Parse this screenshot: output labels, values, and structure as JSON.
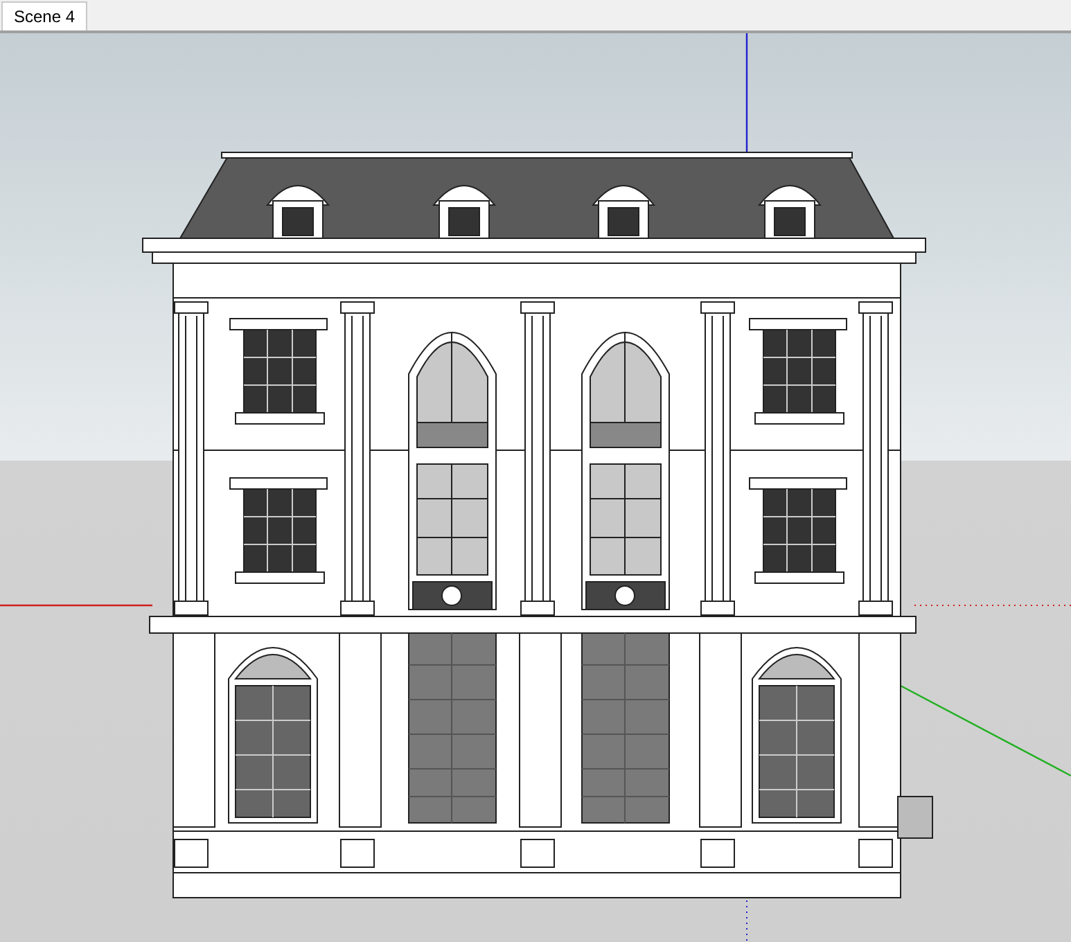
{
  "scene_tabs": [
    {
      "label": "Scene 4",
      "selected": true
    }
  ]
}
